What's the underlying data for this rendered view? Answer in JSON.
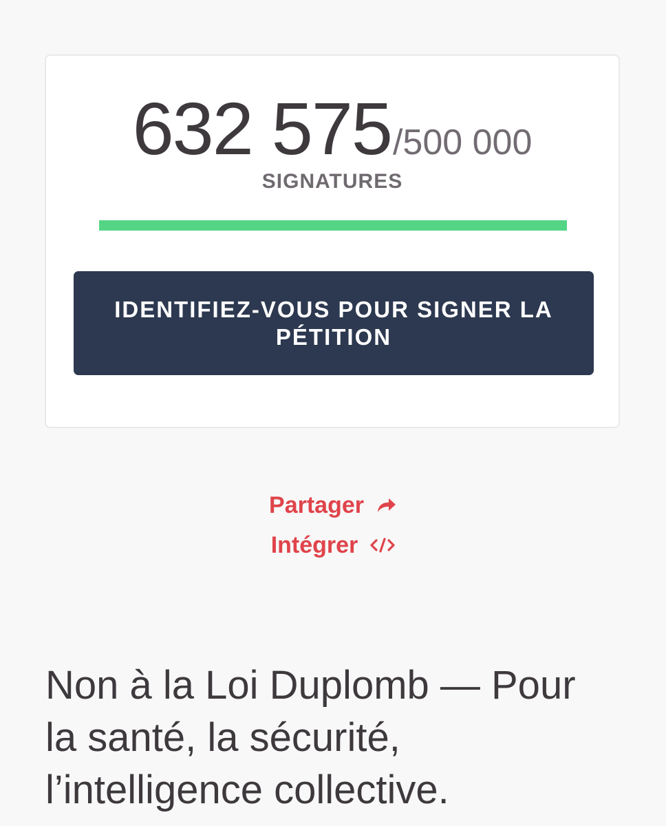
{
  "petition": {
    "signatures_count": "632 575",
    "signatures_goal": "/500 000",
    "signatures_label": "SIGNATURES",
    "progress_percent": 100,
    "sign_button_label": "IDENTIFIEZ-VOUS POUR SIGNER LA PÉTITION",
    "title": "Non à la Loi Duplomb — Pour la santé, la sécurité, l’intelligence collective."
  },
  "actions": {
    "share_label": "Partager",
    "share_icon": "share-arrow-icon",
    "embed_label": "Intégrer",
    "embed_icon": "code-icon"
  },
  "colors": {
    "progress": "#54d585",
    "button_bg": "#2d3950",
    "link": "#e0444b",
    "text_dark": "#3d393d"
  }
}
